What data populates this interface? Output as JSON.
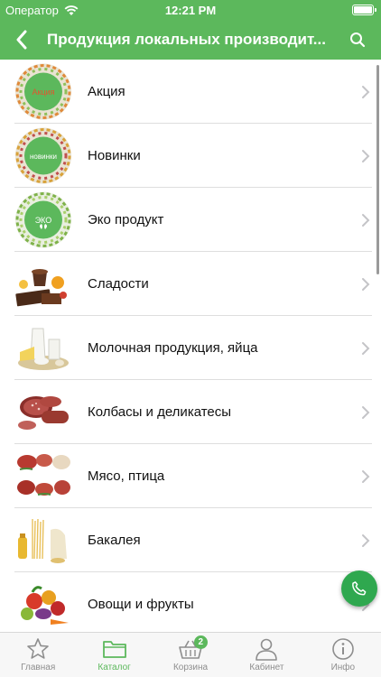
{
  "status_bar": {
    "carrier": "Оператор",
    "time": "12:21 PM"
  },
  "nav": {
    "title": "Продукция локальных производит..."
  },
  "categories": [
    {
      "label": "Акция",
      "thumb_text": "Акция"
    },
    {
      "label": "Новинки",
      "thumb_text": "новинки"
    },
    {
      "label": "Эко продукт",
      "thumb_text": "ЭКО"
    },
    {
      "label": "Сладости"
    },
    {
      "label": "Молочная продукция, яйца"
    },
    {
      "label": "Колбасы и деликатесы"
    },
    {
      "label": "Мясо, птица"
    },
    {
      "label": "Бакалея"
    },
    {
      "label": "Овощи и фрукты"
    }
  ],
  "tabs": [
    {
      "label": "Главная",
      "icon": "star-icon"
    },
    {
      "label": "Каталог",
      "icon": "folder-icon",
      "active": true
    },
    {
      "label": "Корзина",
      "icon": "basket-icon",
      "badge": "2"
    },
    {
      "label": "Кабинет",
      "icon": "user-icon"
    },
    {
      "label": "Инфо",
      "icon": "info-icon"
    }
  ],
  "colors": {
    "accent": "#5cb85c",
    "fab": "#2fa84f"
  }
}
